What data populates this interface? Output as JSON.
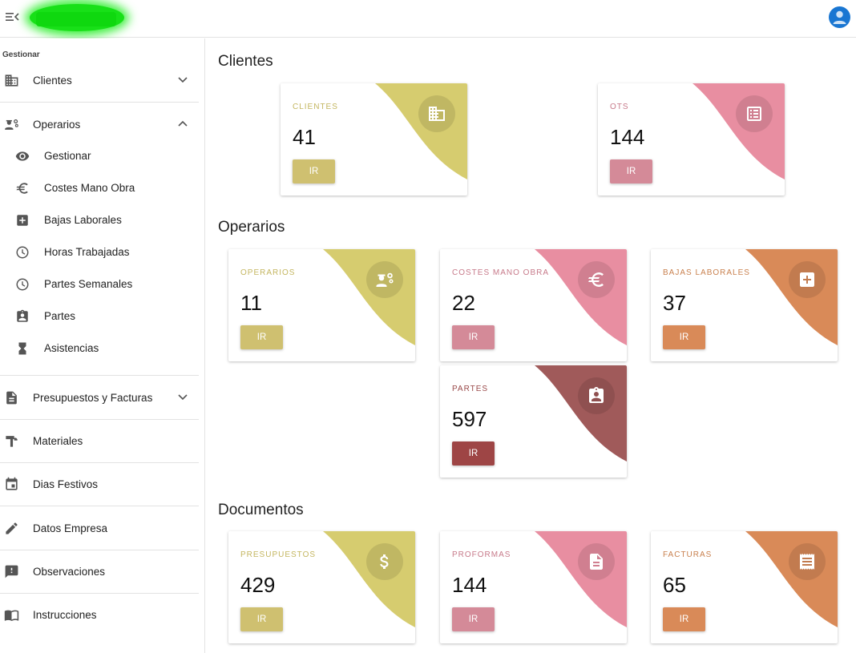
{
  "header": {
    "menu_icon": "menu-open-icon",
    "avatar_icon": "account-icon"
  },
  "sidebar": {
    "heading": "Gestionar",
    "clientes": "Clientes",
    "operarios": "Operarios",
    "operarios_items": [
      {
        "label": "Gestionar",
        "icon": "eye-icon"
      },
      {
        "label": "Costes Mano Obra",
        "icon": "euro-icon"
      },
      {
        "label": "Bajas Laborales",
        "icon": "medical-plus-icon"
      },
      {
        "label": "Horas Trabajadas",
        "icon": "clock-icon"
      },
      {
        "label": "Partes Semanales",
        "icon": "clock-icon"
      },
      {
        "label": "Partes",
        "icon": "badge-icon"
      },
      {
        "label": "Asistencias",
        "icon": "hourglass-icon"
      }
    ],
    "presupuestos": "Presupuestos y Facturas",
    "materiales": "Materiales",
    "dias_festivos": "Dias Festivos",
    "datos_empresa": "Datos Empresa",
    "observaciones": "Observaciones",
    "instrucciones": "Instrucciones"
  },
  "sections": {
    "clientes": "Clientes",
    "operarios": "Operarios",
    "documentos": "Documentos"
  },
  "button_label": "IR",
  "colors": {
    "yellow": "#d6cc6f",
    "yellow_btn": "#cfc070",
    "yellow_text": "#c4b660",
    "pink": "#e88ea1",
    "pink_btn": "#d48a98",
    "pink_text": "#c77a8a",
    "orange": "#d98a58",
    "orange_btn": "#d98a58",
    "orange_text": "#c9814f",
    "brown": "#a05a5a",
    "brown_btn": "#9e4545",
    "brown_text": "#9a4a4a"
  },
  "cards": {
    "clientes": {
      "label": "CLIENTES",
      "value": "41"
    },
    "ots": {
      "label": "OTS",
      "value": "144"
    },
    "operarios": {
      "label": "OPERARIOS",
      "value": "11"
    },
    "costes": {
      "label": "COSTES MANO OBRA",
      "value": "22"
    },
    "bajas": {
      "label": "BAJAS LABORALES",
      "value": "37"
    },
    "partes": {
      "label": "PARTES",
      "value": "597"
    },
    "presupuestos": {
      "label": "PRESUPUESTOS",
      "value": "429"
    },
    "proformas": {
      "label": "PROFORMAS",
      "value": "144"
    },
    "facturas": {
      "label": "FACTURAS",
      "value": "65"
    }
  }
}
